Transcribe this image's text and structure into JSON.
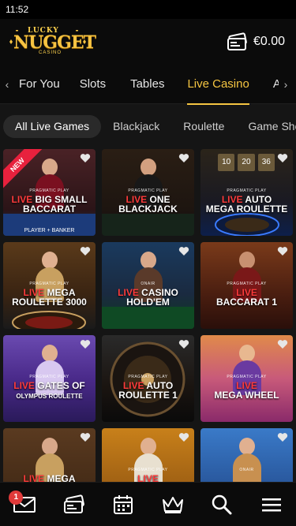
{
  "status": {
    "time": "11:52"
  },
  "header": {
    "logo": {
      "word_top": "LUCKY",
      "word_main": "NUGGET",
      "word_bottom": "CASINO"
    },
    "balance": "€0.00",
    "wallet_icon": "wallet-card-icon"
  },
  "nav": {
    "tabs": [
      {
        "label": "For You"
      },
      {
        "label": "Slots"
      },
      {
        "label": "Tables"
      },
      {
        "label": "Live Casino",
        "active": true
      },
      {
        "label": "Arc"
      }
    ]
  },
  "filters": [
    {
      "label": "All Live Games",
      "active": true
    },
    {
      "label": "Blackjack"
    },
    {
      "label": "Roulette"
    },
    {
      "label": "Game Sho"
    }
  ],
  "games": [
    {
      "live": "LIVE",
      "line1": "BIG SMALL",
      "line2": "BACCARAT",
      "sub": "PLAYER + BANKER",
      "provider": "PRAGMATIC PLAY",
      "ribbon": "NEW"
    },
    {
      "live": "LIVE",
      "line1": "ONE",
      "line2": "BLACKJACK",
      "provider": "PRAGMATIC PLAY"
    },
    {
      "live": "LIVE",
      "line1": "AUTO",
      "line2": "MEGA ROULETTE",
      "provider": "PRAGMATIC PLAY",
      "numbers": [
        "10",
        "20",
        "36"
      ]
    },
    {
      "live": "LIVE",
      "line1": "MEGA",
      "line2": "ROULETTE 3000",
      "provider": "PRAGMATIC PLAY"
    },
    {
      "live": "LIVE",
      "line1": "CASINO",
      "line2": "HOLD'EM",
      "provider": "ONAIR"
    },
    {
      "live": "LIVE",
      "line1": "",
      "line2": "BACCARAT 1",
      "provider": "PRAGMATIC PLAY"
    },
    {
      "live": "LIVE",
      "line1": "GATES OF",
      "line2": "OLYMPUS ROULETTE",
      "provider": "PRAGMATIC PLAY"
    },
    {
      "live": "LIVE",
      "line1": "AUTO",
      "line2": "ROULETTE 1",
      "provider": "PRAGMATIC PLAY"
    },
    {
      "live": "LIVE",
      "line1": "",
      "line2": "MEGA WHEEL",
      "provider": "PRAGMATIC PLAY"
    },
    {
      "live": "LIVE",
      "line1": "MEGA",
      "line2": "",
      "provider": ""
    },
    {
      "live": "LIVE",
      "line1": "",
      "line2": "",
      "provider": "PRAGMATIC PLAY"
    },
    {
      "live": "",
      "line1": "",
      "line2": "",
      "provider": "ONAIR"
    }
  ],
  "bottom_nav": [
    {
      "icon": "mail-icon",
      "badge": "1"
    },
    {
      "icon": "cashier-icon"
    },
    {
      "icon": "calendar-icon"
    },
    {
      "icon": "crown-icon"
    },
    {
      "icon": "search-icon"
    },
    {
      "icon": "menu-icon"
    }
  ],
  "colors": {
    "accent": "#f5c542",
    "live_red": "#ff3b3b",
    "ribbon": "#e8213d",
    "badge": "#e03a3a"
  }
}
